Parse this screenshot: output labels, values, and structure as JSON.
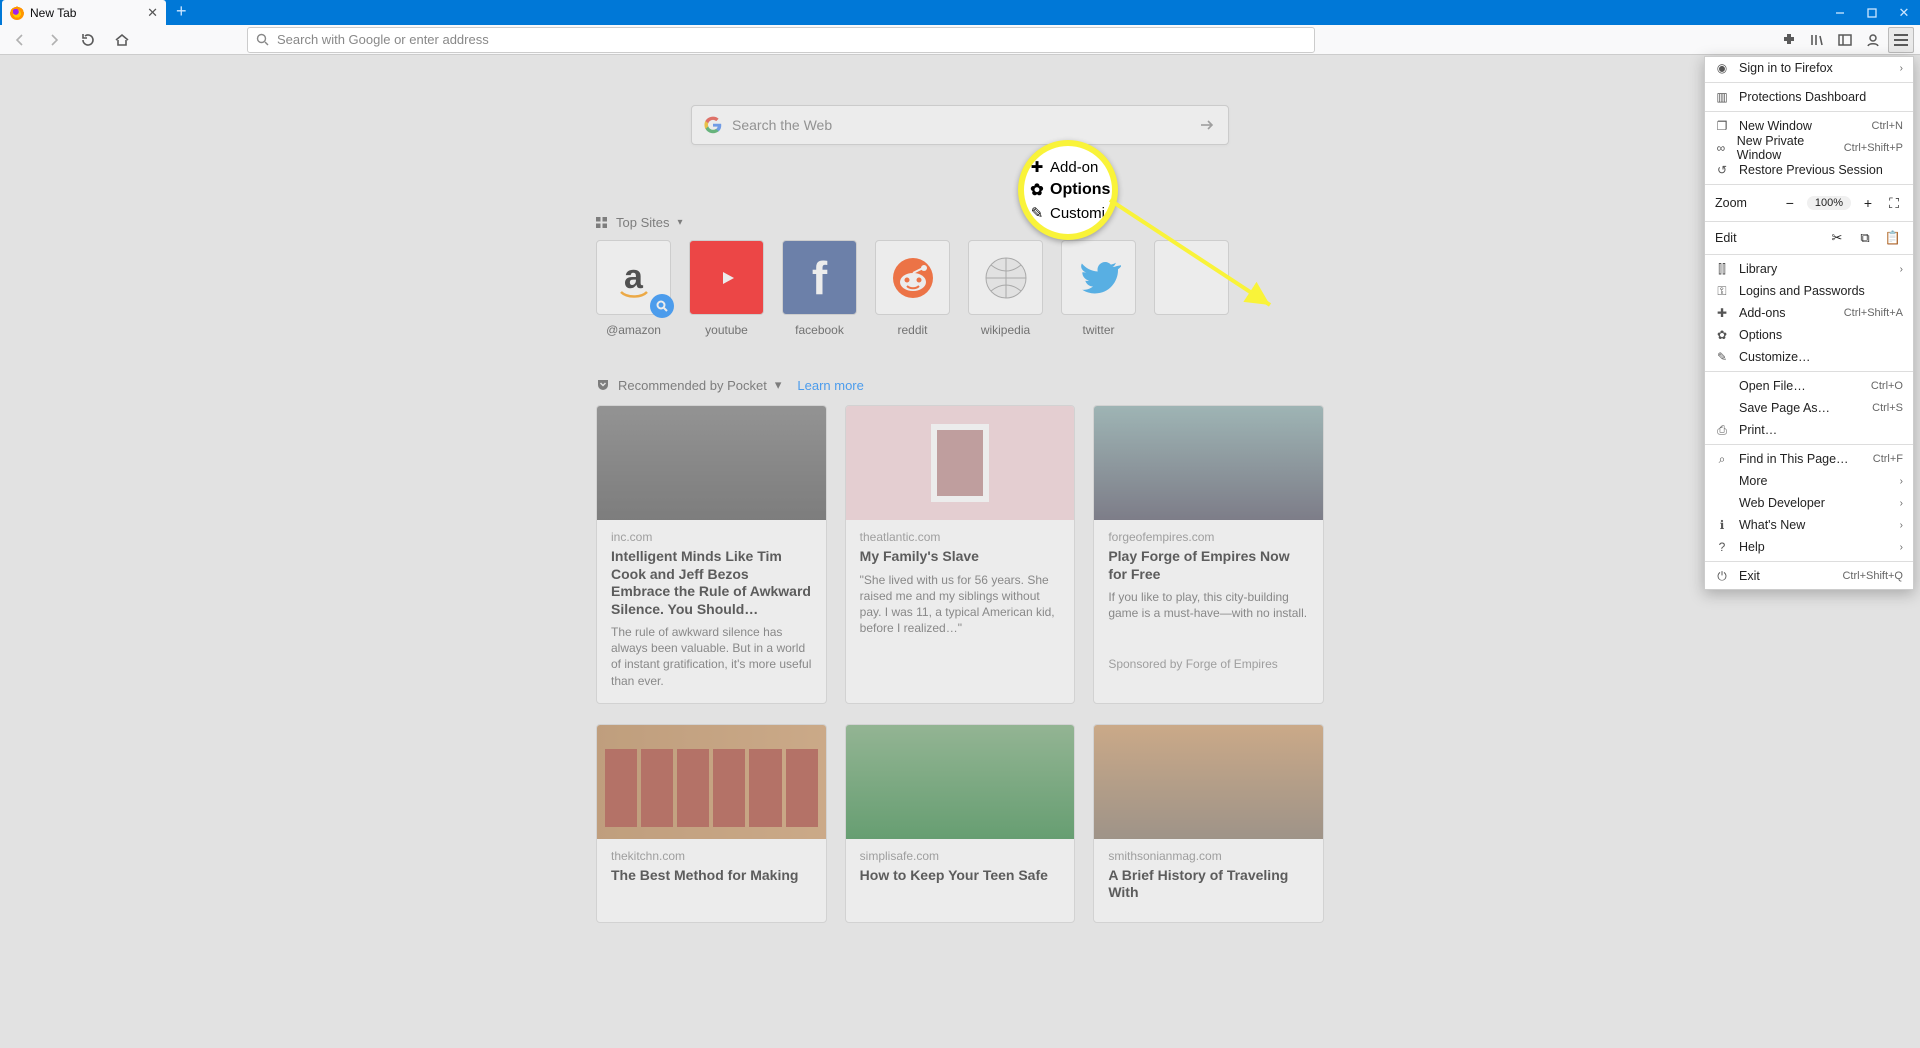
{
  "window": {
    "tab_title": "New Tab"
  },
  "nav": {
    "urlbar_placeholder": "Search with Google or enter address"
  },
  "ntp": {
    "search_placeholder": "Search the Web",
    "topsites_label": "Top Sites",
    "sites": [
      {
        "label": "@amazon",
        "kind": "amazon"
      },
      {
        "label": "youtube",
        "kind": "youtube"
      },
      {
        "label": "facebook",
        "kind": "facebook"
      },
      {
        "label": "reddit",
        "kind": "reddit"
      },
      {
        "label": "wikipedia",
        "kind": "wikipedia"
      },
      {
        "label": "twitter",
        "kind": "twitter"
      }
    ],
    "pocket_label": "Recommended by Pocket",
    "learn_more": "Learn more"
  },
  "cards": [
    {
      "domain": "inc.com",
      "title": "Intelligent Minds Like Tim Cook and Jeff Bezos Embrace the Rule of Awkward Silence. You Should…",
      "desc": "The rule of awkward silence has always been valuable. But in a world of instant gratification, it's more useful than ever."
    },
    {
      "domain": "theatlantic.com",
      "title": "My Family's Slave",
      "desc": "\"She lived with us for 56 years. She raised me and my siblings without pay. I was 11, a typical American kid, before I realized…\""
    },
    {
      "domain": "forgeofempires.com",
      "title": "Play Forge of Empires Now for Free",
      "desc": "If you like to play, this city-building game is a must-have—with no install.",
      "sponsor": "Sponsored by Forge of Empires"
    }
  ],
  "cards2": [
    {
      "domain": "thekitchn.com",
      "title": "The Best Method for Making"
    },
    {
      "domain": "simplisafe.com",
      "title": "How to Keep Your Teen Safe"
    },
    {
      "domain": "smithsonianmag.com",
      "title": "A Brief History of Traveling With"
    }
  ],
  "menu": {
    "sign_in": "Sign in to Firefox",
    "protections": "Protections Dashboard",
    "new_window": "New Window",
    "new_window_k": "Ctrl+N",
    "private_window": "New Private Window",
    "private_window_k": "Ctrl+Shift+P",
    "restore": "Restore Previous Session",
    "zoom_label": "Zoom",
    "zoom_value": "100%",
    "edit_label": "Edit",
    "library": "Library",
    "logins": "Logins and Passwords",
    "addons": "Add-ons",
    "addons_k": "Ctrl+Shift+A",
    "options": "Options",
    "customize": "Customize…",
    "open_file": "Open File…",
    "open_file_k": "Ctrl+O",
    "save_page": "Save Page As…",
    "save_page_k": "Ctrl+S",
    "print": "Print…",
    "find": "Find in This Page…",
    "find_k": "Ctrl+F",
    "more": "More",
    "webdev": "Web Developer",
    "whats_new": "What's New",
    "help": "Help",
    "exit": "Exit",
    "exit_k": "Ctrl+Shift+Q"
  },
  "callout": {
    "addons": "Add-on",
    "options": "Options",
    "customize": "Customi"
  },
  "colors": {
    "titlebar": "#0078d7",
    "highlight": "#f9f339",
    "link": "#0a84ff"
  }
}
